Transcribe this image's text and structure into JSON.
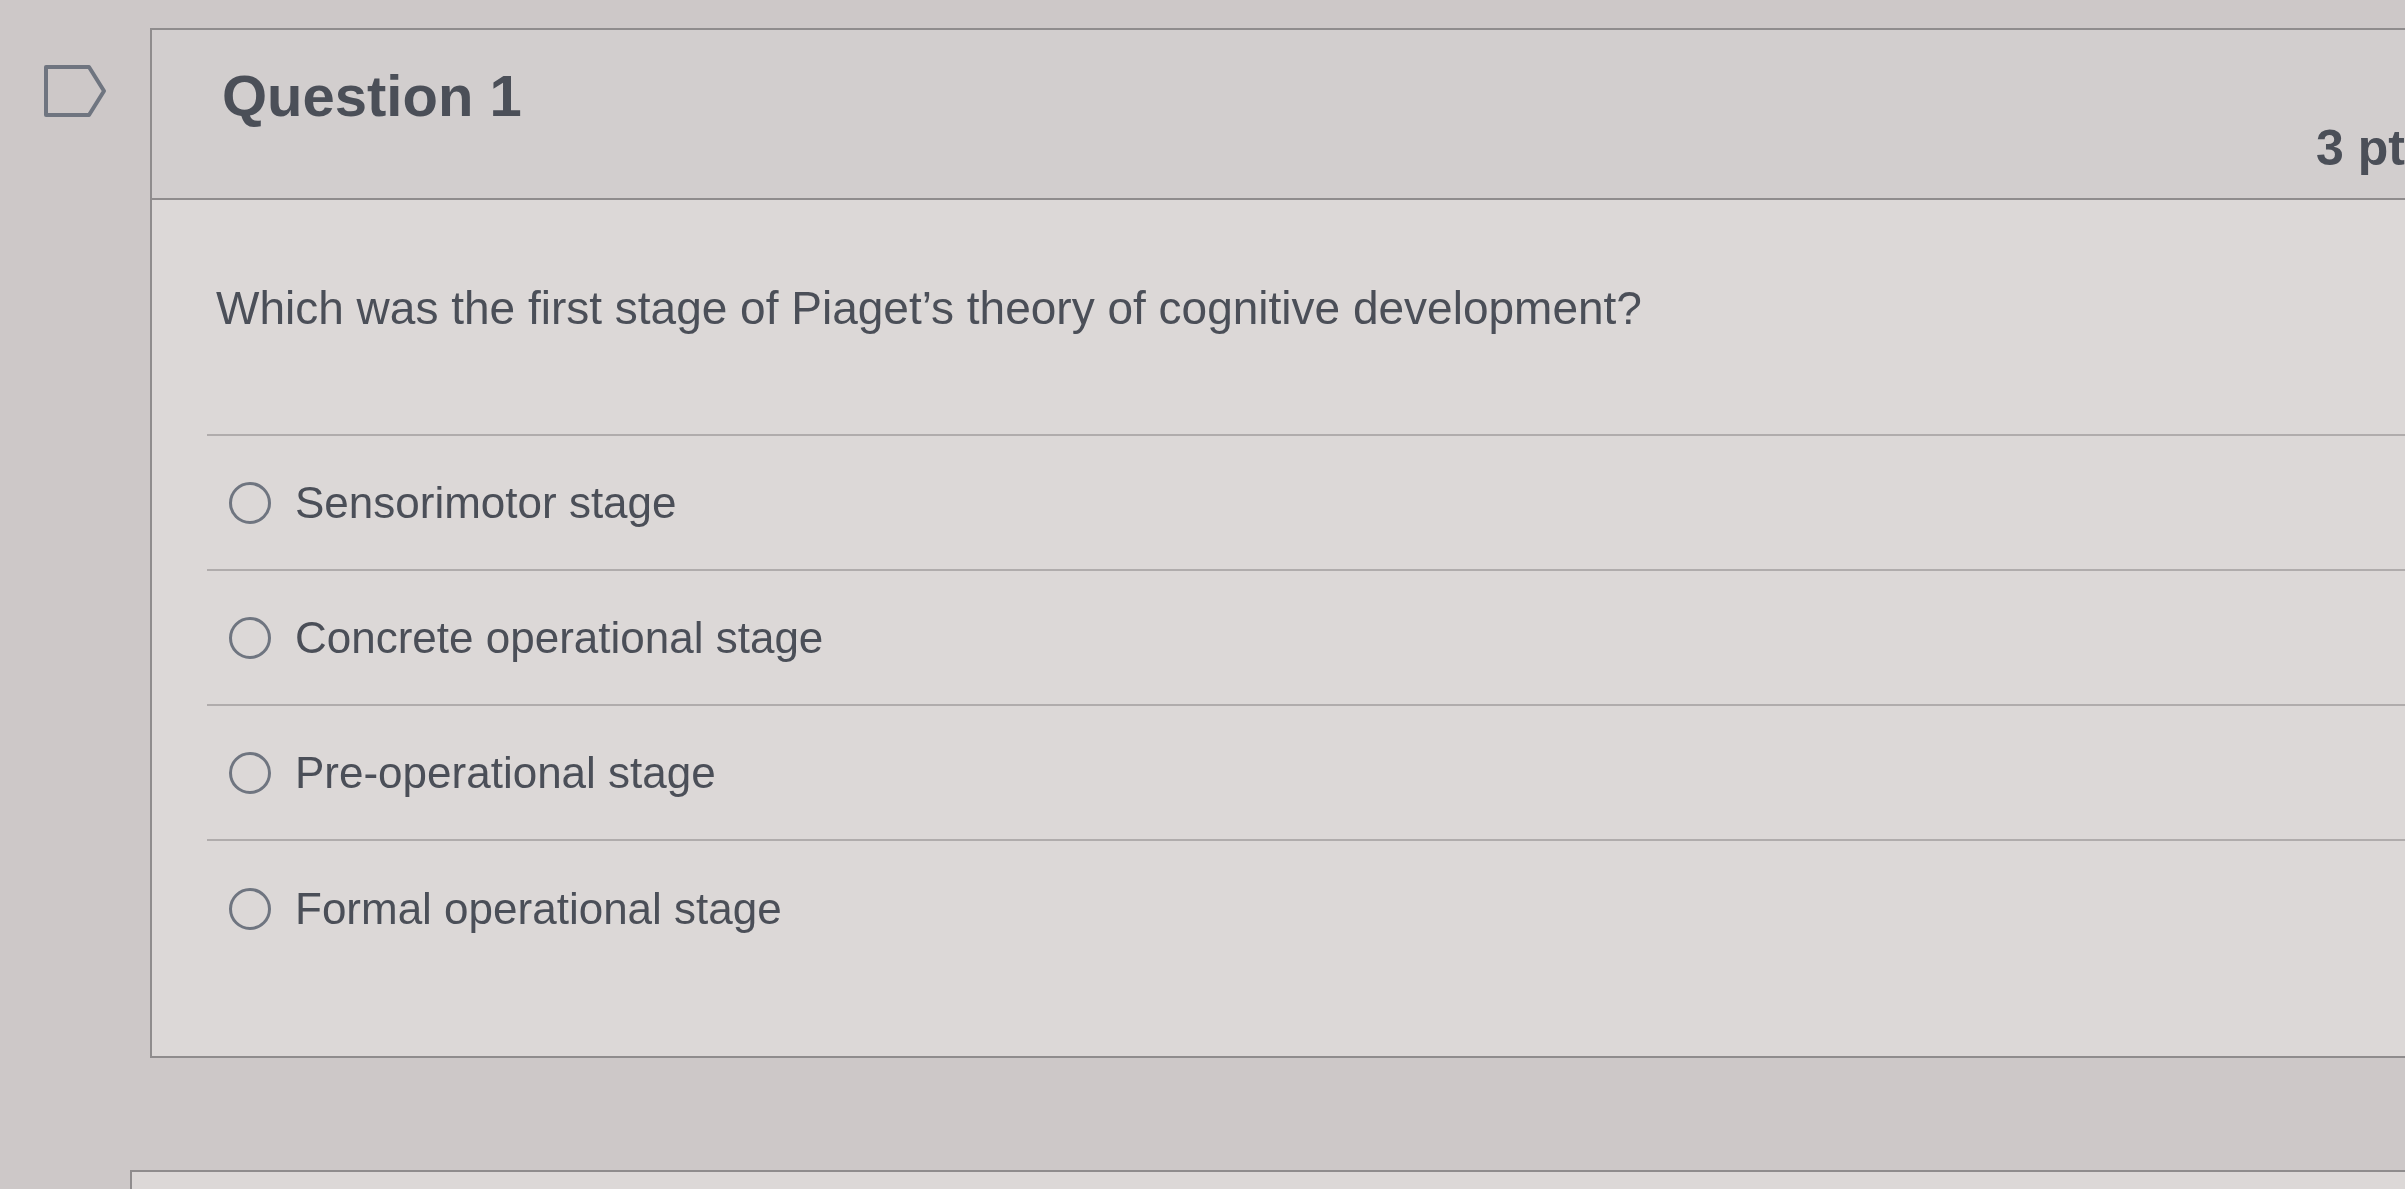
{
  "question": {
    "flagged": false,
    "title": "Question 1",
    "points": "3 pt",
    "text": "Which was the first stage of Piaget’s theory of cognitive development?",
    "options": [
      {
        "label": "Sensorimotor stage",
        "selected": false
      },
      {
        "label": "Concrete operational stage",
        "selected": false
      },
      {
        "label": "Pre-operational stage",
        "selected": false
      },
      {
        "label": "Formal operational stage",
        "selected": false
      }
    ]
  }
}
